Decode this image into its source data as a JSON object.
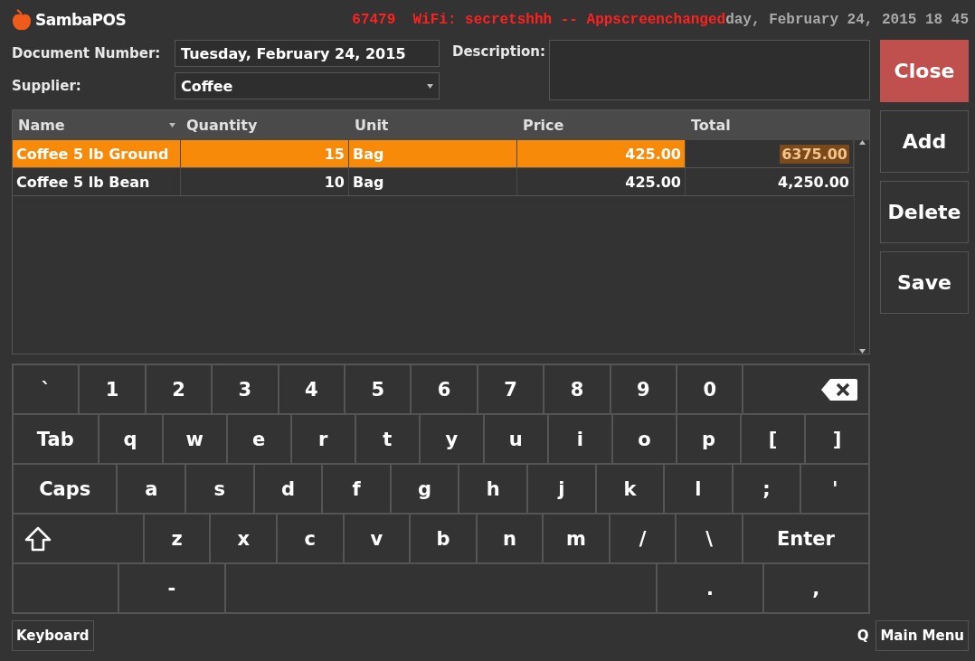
{
  "header": {
    "app_name": "SambaPOS",
    "clock": "day, February 24, 2015 18 45",
    "notice": "67479  WiFi: secretshhh -- Appscreenchanged"
  },
  "form": {
    "document_number_label": "Document Number:",
    "document_number": "Tuesday, February 24, 2015",
    "supplier_label": "Supplier:",
    "supplier": "Coffee",
    "description_label": "Description:"
  },
  "table": {
    "columns": [
      {
        "label": "Name",
        "sorted": true
      },
      {
        "label": "Quantity",
        "sorted": false
      },
      {
        "label": "Unit",
        "sorted": false
      },
      {
        "label": "Price",
        "sorted": false
      },
      {
        "label": "Total",
        "sorted": false
      }
    ],
    "rows": [
      {
        "selected": true,
        "editing_total": true,
        "cells": [
          "Coffee 5 lb Ground",
          "15",
          "Bag",
          "425.00",
          "6375.00"
        ]
      },
      {
        "selected": false,
        "editing_total": false,
        "cells": [
          "Coffee 5 lb Bean",
          "10",
          "Bag",
          "425.00",
          "4,250.00"
        ]
      }
    ]
  },
  "actions": [
    {
      "label": "Close",
      "kind": "danger"
    },
    {
      "label": "Add",
      "kind": "normal"
    },
    {
      "label": "Delete",
      "kind": "normal"
    },
    {
      "label": "Save",
      "kind": "normal"
    }
  ],
  "keyboard": [
    [
      {
        "kind": "char",
        "label": "`"
      },
      {
        "kind": "char",
        "label": "1"
      },
      {
        "kind": "char",
        "label": "2"
      },
      {
        "kind": "char",
        "label": "3"
      },
      {
        "kind": "char",
        "label": "4"
      },
      {
        "kind": "char",
        "label": "5"
      },
      {
        "kind": "char",
        "label": "6"
      },
      {
        "kind": "char",
        "label": "7"
      },
      {
        "kind": "char",
        "label": "8"
      },
      {
        "kind": "char",
        "label": "9"
      },
      {
        "kind": "char",
        "label": "0"
      },
      {
        "kind": "backspace"
      }
    ],
    [
      {
        "kind": "tab",
        "label": "Tab"
      },
      {
        "kind": "char",
        "label": "q"
      },
      {
        "kind": "char",
        "label": "w"
      },
      {
        "kind": "char",
        "label": "e"
      },
      {
        "kind": "char",
        "label": "r"
      },
      {
        "kind": "char",
        "label": "t"
      },
      {
        "kind": "char",
        "label": "y"
      },
      {
        "kind": "char",
        "label": "u"
      },
      {
        "kind": "char",
        "label": "i"
      },
      {
        "kind": "char",
        "label": "o"
      },
      {
        "kind": "char",
        "label": "p"
      },
      {
        "kind": "char",
        "label": "["
      },
      {
        "kind": "char",
        "label": "]"
      }
    ],
    [
      {
        "kind": "caps",
        "label": "Caps"
      },
      {
        "kind": "char",
        "label": "a"
      },
      {
        "kind": "char",
        "label": "s"
      },
      {
        "kind": "char",
        "label": "d"
      },
      {
        "kind": "char",
        "label": "f"
      },
      {
        "kind": "char",
        "label": "g"
      },
      {
        "kind": "char",
        "label": "h"
      },
      {
        "kind": "char",
        "label": "j"
      },
      {
        "kind": "char",
        "label": "k"
      },
      {
        "kind": "char",
        "label": "l"
      },
      {
        "kind": "char",
        "label": ";"
      },
      {
        "kind": "char",
        "label": "'"
      }
    ],
    [
      {
        "kind": "shift"
      },
      {
        "kind": "narrow",
        "label": "z"
      },
      {
        "kind": "narrow",
        "label": "x"
      },
      {
        "kind": "narrow",
        "label": "c"
      },
      {
        "kind": "narrow",
        "label": "v"
      },
      {
        "kind": "narrow",
        "label": "b"
      },
      {
        "kind": "narrow",
        "label": "n"
      },
      {
        "kind": "narrow",
        "label": "m"
      },
      {
        "kind": "narrow",
        "label": "/"
      },
      {
        "kind": "narrow",
        "label": "\\"
      },
      {
        "kind": "enter",
        "label": "Enter"
      }
    ],
    [
      {
        "kind": "blank"
      },
      {
        "kind": "wide",
        "label": "-"
      },
      {
        "kind": "space"
      },
      {
        "kind": "wide",
        "label": "."
      },
      {
        "kind": "wide",
        "label": ","
      }
    ]
  ],
  "footer": {
    "keyboard_button": "Keyboard",
    "shortcut": "Q",
    "main_menu": "Main Menu"
  }
}
